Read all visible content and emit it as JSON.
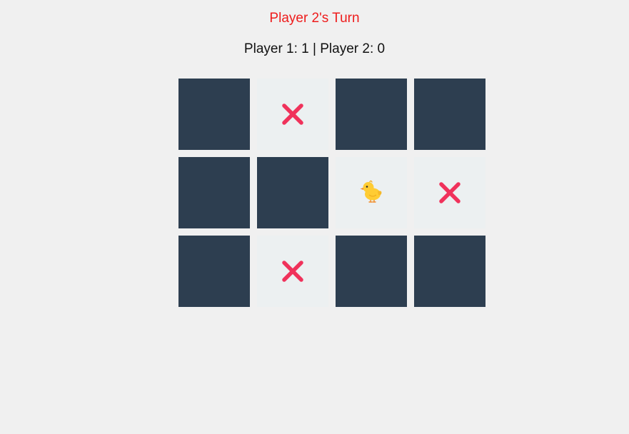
{
  "status": {
    "turn_text": "Player 2's Turn",
    "turn_color": "#ee1c1c"
  },
  "score": {
    "text": "Player 1: 1 | Player 2: 0"
  },
  "colors": {
    "hidden_tile": "#2d3e50",
    "revealed_tile": "#ecf0f1",
    "x_mark": "#f0325b"
  },
  "board": {
    "rows": 3,
    "cols": 4,
    "tiles": [
      {
        "state": "hidden",
        "symbol": ""
      },
      {
        "state": "revealed",
        "symbol": "x-icon"
      },
      {
        "state": "hidden",
        "symbol": ""
      },
      {
        "state": "hidden",
        "symbol": ""
      },
      {
        "state": "hidden",
        "symbol": ""
      },
      {
        "state": "hidden",
        "symbol": ""
      },
      {
        "state": "revealed",
        "symbol": "chick-icon"
      },
      {
        "state": "revealed",
        "symbol": "x-icon"
      },
      {
        "state": "hidden",
        "symbol": ""
      },
      {
        "state": "revealed",
        "symbol": "x-icon"
      },
      {
        "state": "hidden",
        "symbol": ""
      },
      {
        "state": "hidden",
        "symbol": ""
      }
    ]
  }
}
